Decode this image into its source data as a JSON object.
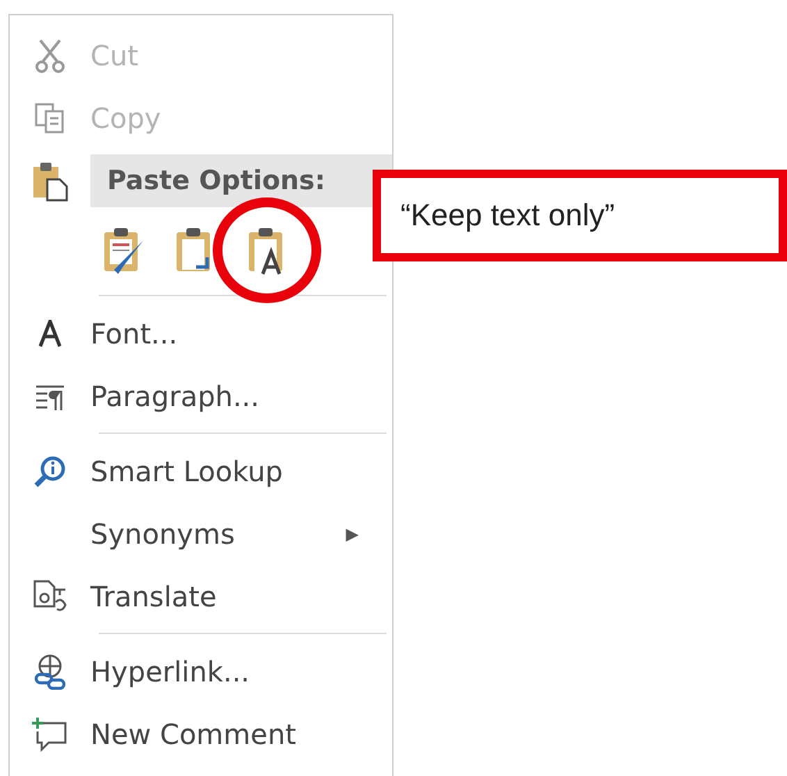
{
  "menu": {
    "items": [
      {
        "kind": "item",
        "label": "Cut",
        "disabled": true
      },
      {
        "kind": "item",
        "label": "Copy",
        "disabled": true
      },
      {
        "kind": "header",
        "label": "Paste Options:"
      },
      {
        "kind": "paste-options",
        "options": [
          {
            "highlighted": false
          },
          {
            "highlighted": false
          },
          {
            "highlighted": true
          }
        ]
      },
      {
        "kind": "divider"
      },
      {
        "kind": "item",
        "label": "Font...",
        "disabled": false
      },
      {
        "kind": "item",
        "label": "Paragraph...",
        "disabled": false
      },
      {
        "kind": "divider"
      },
      {
        "kind": "item",
        "label": "Smart Lookup",
        "disabled": false
      },
      {
        "kind": "item",
        "label": "Synonyms",
        "disabled": false,
        "arrow": "▶"
      },
      {
        "kind": "item",
        "label": "Translate",
        "disabled": false
      },
      {
        "kind": "divider"
      },
      {
        "kind": "item",
        "label": "Hyperlink...",
        "disabled": false
      },
      {
        "kind": "item",
        "label": "New Comment",
        "disabled": false
      }
    ]
  },
  "callout": {
    "text": "“Keep text only”"
  }
}
